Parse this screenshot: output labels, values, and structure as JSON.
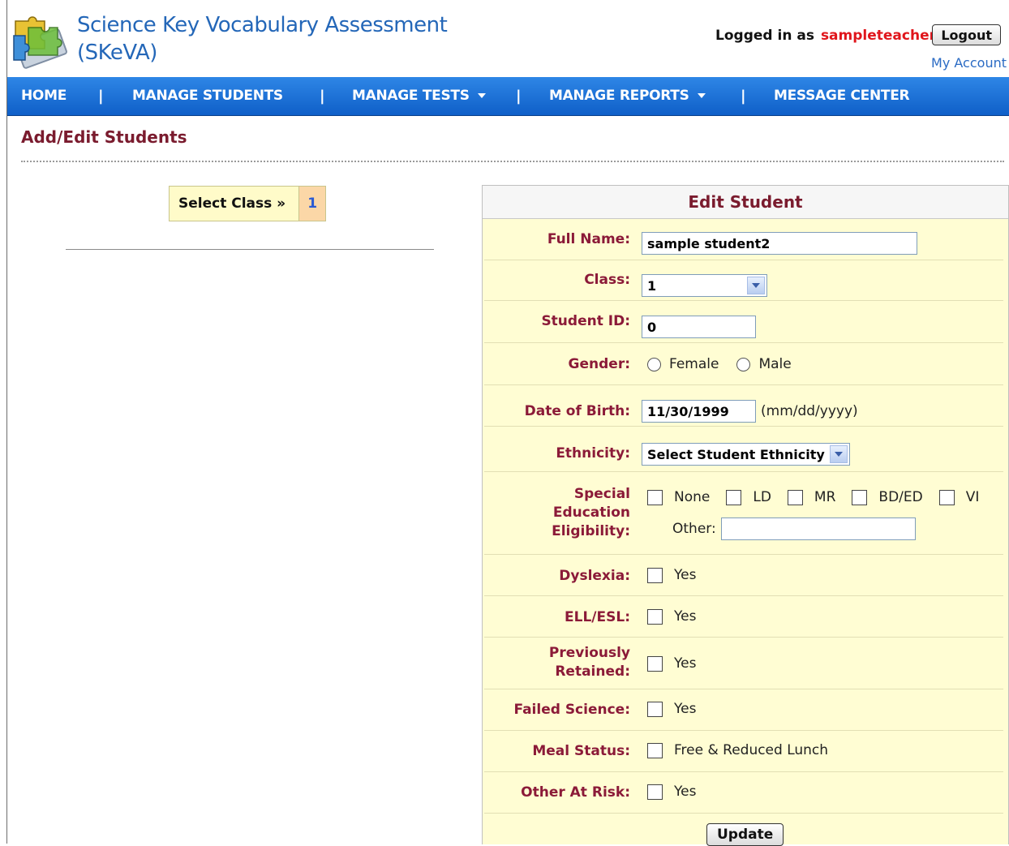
{
  "header": {
    "title": "Science Key Vocabulary Assessment (SKeVA)",
    "logged_in_label": "Logged in as",
    "username": "sampleteacher",
    "logout_label": "Logout",
    "my_account_label": "My Account"
  },
  "nav": {
    "home": "HOME",
    "manage_students": "MANAGE STUDENTS",
    "manage_tests": "MANAGE TESTS",
    "manage_reports": "MANAGE REPORTS",
    "message_center": "MESSAGE CENTER",
    "separator": "|"
  },
  "page": {
    "title": "Add/Edit Students"
  },
  "class_selector": {
    "label": "Select Class »",
    "options": [
      "1"
    ]
  },
  "form": {
    "heading": "Edit Student",
    "full_name": {
      "label": "Full Name:",
      "value": "sample student2"
    },
    "class": {
      "label": "Class:",
      "value": "1"
    },
    "student_id": {
      "label": "Student ID:",
      "value": "0"
    },
    "gender": {
      "label": "Gender:",
      "options": [
        "Female",
        "Male"
      ]
    },
    "dob": {
      "label": "Date of Birth:",
      "value": "11/30/1999",
      "hint": "(mm/dd/yyyy)"
    },
    "ethnicity": {
      "label": "Ethnicity:",
      "value": "Select Student Ethnicity"
    },
    "special_ed": {
      "label_line1": "Special",
      "label_line2": "Education",
      "label_line3": "Eligibility:",
      "options": [
        "None",
        "LD",
        "MR",
        "BD/ED",
        "VI"
      ],
      "other_label": "Other:",
      "other_value": ""
    },
    "dyslexia": {
      "label": "Dyslexia:",
      "option": "Yes"
    },
    "ell_esl": {
      "label": "ELL/ESL:",
      "option": "Yes"
    },
    "previously_retained": {
      "label_line1": "Previously",
      "label_line2": "Retained:",
      "option": "Yes"
    },
    "failed_science": {
      "label": "Failed Science:",
      "option": "Yes"
    },
    "meal_status": {
      "label": "Meal Status:",
      "option": "Free & Reduced Lunch"
    },
    "other_at_risk": {
      "label": "Other At Risk:",
      "option": "Yes"
    },
    "update_label": "Update"
  },
  "colors": {
    "nav_blue": "#1a6fd8",
    "label_maroon": "#8b1a38",
    "username_red": "#e0161c",
    "panel_bg": "#fffdd3"
  }
}
